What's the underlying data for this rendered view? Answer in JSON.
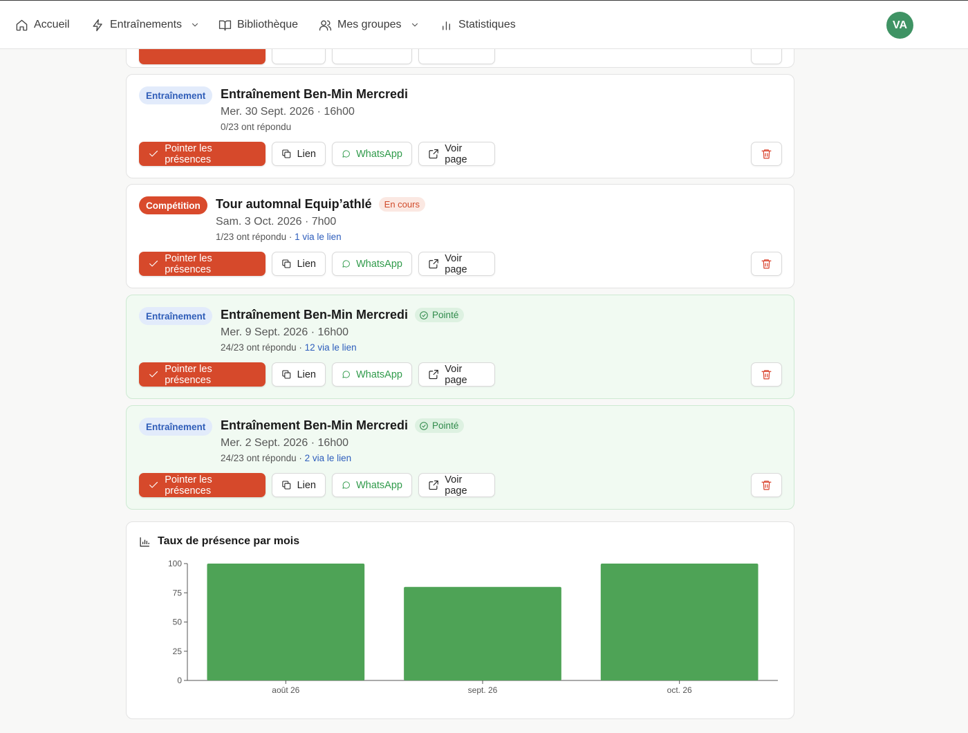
{
  "nav": {
    "items": [
      {
        "label": "Accueil",
        "icon": "home-icon"
      },
      {
        "label": "Entraînements",
        "icon": "lightning-icon",
        "dropdown": true
      },
      {
        "label": "Bibliothèque",
        "icon": "book-icon"
      },
      {
        "label": "Mes groupes",
        "icon": "users-icon",
        "dropdown": true
      },
      {
        "label": "Statistiques",
        "icon": "bar-chart-icon"
      }
    ],
    "avatar": "VA"
  },
  "buttons": {
    "pointer": "Pointer les présences",
    "lien": "Lien",
    "whatsapp": "WhatsApp",
    "voir": "Voir page"
  },
  "events": [
    {
      "type": "Entraînement",
      "title": "Entraînement Ben-Min Mercredi",
      "date": "Mer. 30 Sept. 2026 · 16h00",
      "responses": "0/23 ont répondu",
      "link_note": "",
      "status": ""
    },
    {
      "type": "Compétition",
      "title": "Tour automnal Equip’athlé",
      "date": "Sam. 3 Oct. 2026 · 7h00",
      "responses": "1/23 ont répondu · ",
      "link_note": "1 via le lien",
      "status": "En cours"
    },
    {
      "type": "Entraînement",
      "title": "Entraînement Ben-Min Mercredi",
      "date": "Mer. 9 Sept. 2026 · 16h00",
      "responses": "24/23 ont répondu · ",
      "link_note": "12 via le lien",
      "status": "Pointé"
    },
    {
      "type": "Entraînement",
      "title": "Entraînement Ben-Min Mercredi",
      "date": "Mer. 2 Sept. 2026 · 16h00",
      "responses": "24/23 ont répondu · ",
      "link_note": "2 via le lien",
      "status": "Pointé"
    }
  ],
  "chart_data": {
    "type": "bar",
    "title": "Taux de présence par mois",
    "categories": [
      "août 26",
      "sept. 26",
      "oct. 26"
    ],
    "values": [
      100,
      80,
      100
    ],
    "yticks": [
      0,
      25,
      50,
      75,
      100
    ],
    "ylim": [
      0,
      100
    ],
    "bar_color": "#4ea356",
    "grid": false
  }
}
